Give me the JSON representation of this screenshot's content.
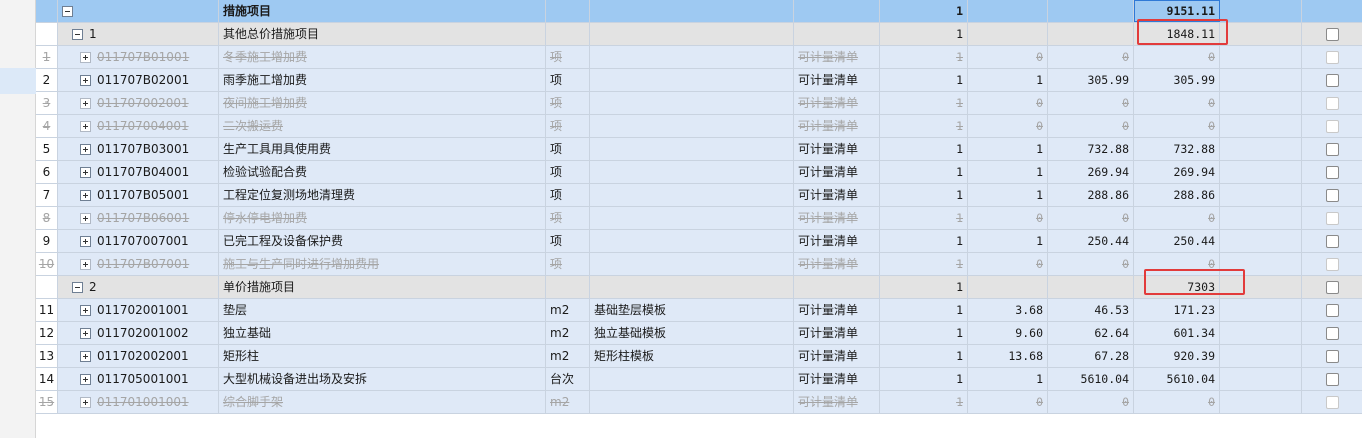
{
  "top_row": {
    "name": "措施项目",
    "qty": "1",
    "total": "9151.11"
  },
  "groups": [
    {
      "code": "1",
      "name": "其他总价措施项目",
      "qty": "1",
      "total": "1848.11",
      "rows": [
        {
          "seq": "1",
          "code": "011707B01001",
          "name": "冬季施工增加费",
          "unit": "项",
          "feature": "",
          "type": "可计量清单",
          "qty1": "1",
          "qty2": "0",
          "price": "0",
          "total": "0",
          "disabled": true
        },
        {
          "seq": "2",
          "code": "011707B02001",
          "name": "雨季施工增加费",
          "unit": "项",
          "feature": "",
          "type": "可计量清单",
          "qty1": "1",
          "qty2": "1",
          "price": "305.99",
          "total": "305.99",
          "disabled": false
        },
        {
          "seq": "3",
          "code": "011707002001",
          "name": "夜间施工增加费",
          "unit": "项",
          "feature": "",
          "type": "可计量清单",
          "qty1": "1",
          "qty2": "0",
          "price": "0",
          "total": "0",
          "disabled": true
        },
        {
          "seq": "4",
          "code": "011707004001",
          "name": "二次搬运费",
          "unit": "项",
          "feature": "",
          "type": "可计量清单",
          "qty1": "1",
          "qty2": "0",
          "price": "0",
          "total": "0",
          "disabled": true
        },
        {
          "seq": "5",
          "code": "011707B03001",
          "name": "生产工具用具使用费",
          "unit": "项",
          "feature": "",
          "type": "可计量清单",
          "qty1": "1",
          "qty2": "1",
          "price": "732.88",
          "total": "732.88",
          "disabled": false
        },
        {
          "seq": "6",
          "code": "011707B04001",
          "name": "检验试验配合费",
          "unit": "项",
          "feature": "",
          "type": "可计量清单",
          "qty1": "1",
          "qty2": "1",
          "price": "269.94",
          "total": "269.94",
          "disabled": false
        },
        {
          "seq": "7",
          "code": "011707B05001",
          "name": "工程定位复测场地清理费",
          "unit": "项",
          "feature": "",
          "type": "可计量清单",
          "qty1": "1",
          "qty2": "1",
          "price": "288.86",
          "total": "288.86",
          "disabled": false
        },
        {
          "seq": "8",
          "code": "011707B06001",
          "name": "停水停电增加费",
          "unit": "项",
          "feature": "",
          "type": "可计量清单",
          "qty1": "1",
          "qty2": "0",
          "price": "0",
          "total": "0",
          "disabled": true
        },
        {
          "seq": "9",
          "code": "011707007001",
          "name": "已完工程及设备保护费",
          "unit": "项",
          "feature": "",
          "type": "可计量清单",
          "qty1": "1",
          "qty2": "1",
          "price": "250.44",
          "total": "250.44",
          "disabled": false
        },
        {
          "seq": "10",
          "code": "011707B07001",
          "name": "施工与生产同时进行增加费用",
          "unit": "项",
          "feature": "",
          "type": "可计量清单",
          "qty1": "1",
          "qty2": "0",
          "price": "0",
          "total": "0",
          "disabled": true
        }
      ]
    },
    {
      "code": "2",
      "name": "单价措施项目",
      "qty": "1",
      "total": "7303",
      "rows": [
        {
          "seq": "11",
          "code": "011702001001",
          "name": "垫层",
          "unit": "m2",
          "feature": "基础垫层模板",
          "type": "可计量清单",
          "qty1": "1",
          "qty2": "3.68",
          "price": "46.53",
          "total": "171.23",
          "disabled": false
        },
        {
          "seq": "12",
          "code": "011702001002",
          "name": "独立基础",
          "unit": "m2",
          "feature": "独立基础模板",
          "type": "可计量清单",
          "qty1": "1",
          "qty2": "9.60",
          "price": "62.64",
          "total": "601.34",
          "disabled": false
        },
        {
          "seq": "13",
          "code": "011702002001",
          "name": "矩形柱",
          "unit": "m2",
          "feature": "矩形柱模板",
          "type": "可计量清单",
          "qty1": "1",
          "qty2": "13.68",
          "price": "67.28",
          "total": "920.39",
          "disabled": false
        },
        {
          "seq": "14",
          "code": "011705001001",
          "name": "大型机械设备进出场及安拆",
          "unit": "台次",
          "feature": "",
          "type": "可计量清单",
          "qty1": "1",
          "qty2": "1",
          "price": "5610.04",
          "total": "5610.04",
          "disabled": false
        },
        {
          "seq": "15",
          "code": "011701001001",
          "name": "综合脚手架",
          "unit": "m2",
          "feature": "",
          "type": "可计量清单",
          "qty1": "1",
          "qty2": "0",
          "price": "0",
          "total": "0",
          "disabled": true
        }
      ]
    }
  ],
  "colors": {
    "highlight": "#e23b3b",
    "top_row_bg": "#9ec9f2",
    "group_bg": "#e3e3e3",
    "item_bg": "#dfe9f7"
  },
  "icons": {
    "collapse": "minus-box-icon",
    "expand": "plus-box-icon"
  }
}
